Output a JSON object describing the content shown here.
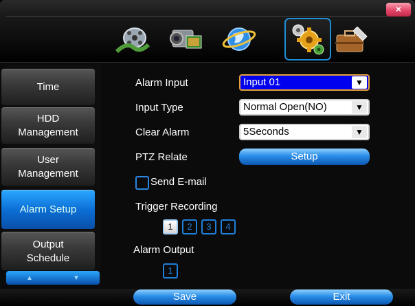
{
  "window": {
    "close_label": "×"
  },
  "toolbar": {
    "tabs": [
      {
        "icon": "film-reel-icon"
      },
      {
        "icon": "camcorder-icon"
      },
      {
        "icon": "globe-network-icon"
      },
      {
        "icon": "gears-icon",
        "active": true
      },
      {
        "icon": "briefcase-tools-icon"
      }
    ]
  },
  "sidebar": {
    "items": [
      {
        "label": "Time"
      },
      {
        "label": "HDD\nManagement"
      },
      {
        "label": "User\nManagement"
      },
      {
        "label": "Alarm Setup",
        "active": true
      },
      {
        "label": "Output\nSchedule"
      }
    ],
    "scroll_up": "▲",
    "scroll_down": "▼"
  },
  "form": {
    "alarm_input_label": "Alarm Input",
    "alarm_input_value": "Input 01",
    "input_type_label": "Input Type",
    "input_type_value": "Normal Open(NO)",
    "clear_alarm_label": "Clear Alarm",
    "clear_alarm_value": "5Seconds",
    "ptz_relate_label": "PTZ Relate",
    "setup_button": "Setup",
    "send_email_label": "Send E-mail",
    "trigger_recording_label": "Trigger Recording",
    "trigger_channels": [
      "1",
      "2",
      "3",
      "4"
    ],
    "alarm_output_label": "Alarm Output",
    "alarm_output_channels": [
      "1"
    ],
    "dropdown_arrow": "▼"
  },
  "footer": {
    "save_label": "Save",
    "exit_label": "Exit"
  },
  "colors": {
    "accent": "#1e8fd8",
    "button_blue": "#2a8ee8",
    "focus_border": "#e9a23a"
  }
}
